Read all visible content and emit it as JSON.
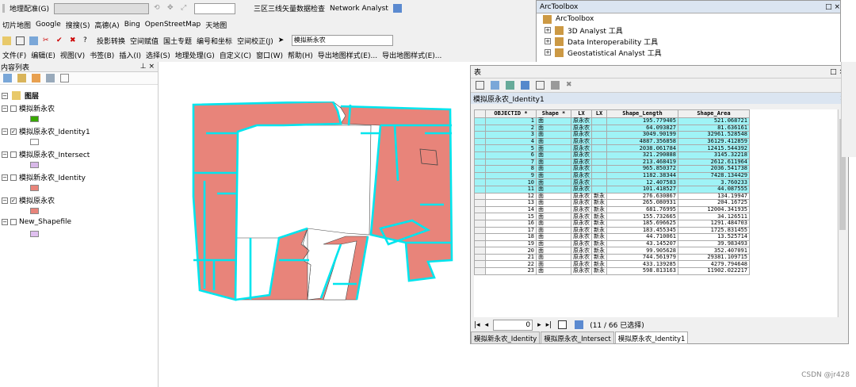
{
  "toolbar1": {
    "georef": "地理配准(G)",
    "network": "三区三线矢量数据检查",
    "network_analyst": "Network Analyst"
  },
  "toolbar2": {
    "slice": "切片地图",
    "google": "Google",
    "search": "搜搜(S)",
    "gaode": "高德(A)",
    "bing": "Bing",
    "osm": "OpenStreetMap",
    "tianditu": "天地图"
  },
  "toolbar3": {
    "proj": "投影转换",
    "spatial": "空间赋值",
    "land": "国土专题",
    "code": "编号和坐标",
    "calib": "空间校正(J)",
    "layer_select": "模拟新永农"
  },
  "menu": [
    "文件(F)",
    "编辑(E)",
    "视图(V)",
    "书签(B)",
    "插入(I)",
    "选择(S)",
    "地理处理(G)",
    "自定义(C)",
    "窗口(W)",
    "帮助(H)",
    "导出地图样式(E)...",
    "导出地图样式(E)..."
  ],
  "toc": {
    "title": "内容列表",
    "root": "图层",
    "layers": [
      {
        "name": "模拟新永农",
        "checked": false,
        "color": "#38a800"
      },
      {
        "name": "模拟原永农_Identity1",
        "checked": true,
        "color": "#ffffff"
      },
      {
        "name": "模拟原永农_Intersect",
        "checked": false,
        "color": "#d8b8e8"
      },
      {
        "name": "模拟新永农_Identity",
        "checked": false,
        "color": "#e8847a"
      },
      {
        "name": "模拟原永农",
        "checked": true,
        "color": "#e8847a"
      },
      {
        "name": "New_Shapefile",
        "checked": false,
        "color": "#e0c0f0"
      }
    ]
  },
  "arctoolbox": {
    "title": "ArcToolbox",
    "root": "ArcToolbox",
    "items": [
      "3D Analyst 工具",
      "Data Interoperability 工具",
      "Geostatistical Analyst 工具"
    ]
  },
  "table": {
    "window_title": "表",
    "table_title": "模拟原永农_Identity1",
    "columns": [
      "OBJECTID *",
      "Shape *",
      "LX",
      "LX",
      "Shape_Length",
      "Shape_Area"
    ],
    "rows": [
      [
        "1",
        "面",
        "原永农",
        "",
        "195.779405",
        "521.068721"
      ],
      [
        "2",
        "面",
        "原永农",
        "",
        "64.093827",
        "81.636161"
      ],
      [
        "3",
        "面",
        "原永农",
        "",
        "3049.90199",
        "32961.528548"
      ],
      [
        "4",
        "面",
        "原永农",
        "",
        "4887.356858",
        "36129.412859"
      ],
      [
        "5",
        "面",
        "原永农",
        "",
        "2038.061784",
        "12415.544392"
      ],
      [
        "6",
        "面",
        "原永农",
        "",
        "321.290888",
        "3145.32218"
      ],
      [
        "7",
        "面",
        "原永农",
        "",
        "213.468419",
        "2612.611964"
      ],
      [
        "8",
        "面",
        "原永农",
        "",
        "965.850372",
        "2036.541738"
      ],
      [
        "9",
        "面",
        "原永农",
        "",
        "1182.38344",
        "7428.134429"
      ],
      [
        "10",
        "面",
        "原永农",
        "",
        "12.407583",
        "3.760233"
      ],
      [
        "11",
        "面",
        "原永农",
        "",
        "101.418527",
        "44.087555"
      ],
      [
        "12",
        "面",
        "原永农",
        "新永",
        "276.630867",
        "134.19947"
      ],
      [
        "13",
        "面",
        "原永农",
        "新永",
        "265.080931",
        "204.16725"
      ],
      [
        "14",
        "面",
        "原永农",
        "新永",
        "681.76995",
        "12004.341935"
      ],
      [
        "15",
        "面",
        "原永农",
        "新永",
        "155.732665",
        "34.126511"
      ],
      [
        "16",
        "面",
        "原永农",
        "新永",
        "185.696625",
        "1291.484703"
      ],
      [
        "17",
        "面",
        "原永农",
        "新永",
        "183.455345",
        "1725.831455"
      ],
      [
        "18",
        "面",
        "原永农",
        "新永",
        "44.710061",
        "13.525714"
      ],
      [
        "19",
        "面",
        "原永农",
        "新永",
        "43.145207",
        "39.983493"
      ],
      [
        "20",
        "面",
        "原永农",
        "新永",
        "99.905628",
        "352.407091"
      ],
      [
        "21",
        "面",
        "原永农",
        "新永",
        "744.561979",
        "29381.109715"
      ],
      [
        "22",
        "面",
        "原永农",
        "新永",
        "433.139285",
        "4279.794648"
      ],
      [
        "23",
        "面",
        "原永农",
        "新永",
        "598.813163",
        "11902.022217"
      ]
    ],
    "selected_count": 11,
    "record": "0",
    "status": "(11 / 66 已选择)",
    "tabs": [
      "模拟新永农_Identity",
      "模拟原永农_Intersect",
      "模拟原永农_Identity1"
    ]
  },
  "watermark": "CSDN @jr428"
}
